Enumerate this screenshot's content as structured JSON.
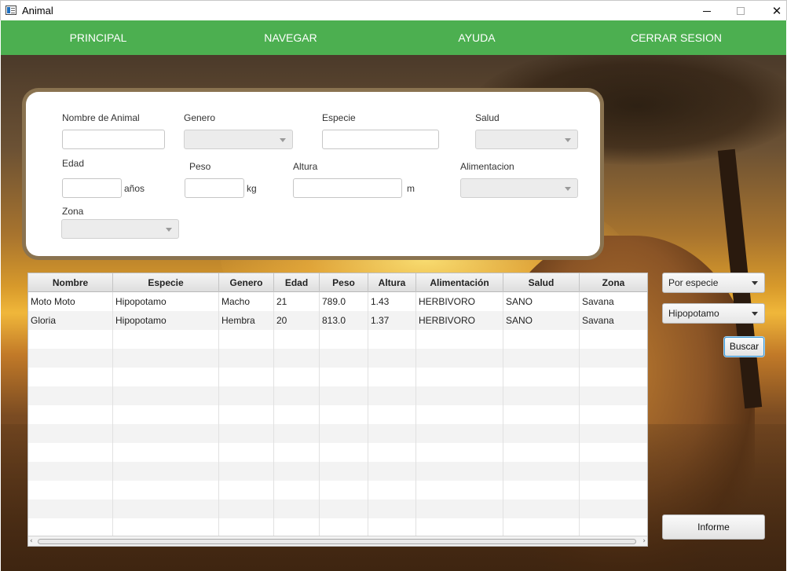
{
  "window": {
    "title": "Animal",
    "icon": "app-window-icon"
  },
  "nav": {
    "principal": "PRINCIPAL",
    "navegar": "NAVEGAR",
    "ayuda": "AYUDA",
    "cerrar_sesion": "CERRAR SESION",
    "color": "#4caf50"
  },
  "form": {
    "nombre_label": "Nombre de Animal",
    "genero_label": "Genero",
    "especie_label": "Especie",
    "salud_label": "Salud",
    "edad_label": "Edad",
    "edad_unit": "años",
    "peso_label": "Peso",
    "peso_unit": "kg",
    "altura_label": "Altura",
    "altura_unit": "m",
    "alimentacion_label": "Alimentacion",
    "zona_label": "Zona",
    "values": {
      "nombre": "",
      "genero": "",
      "especie": "",
      "salud": "",
      "edad": "",
      "peso": "",
      "altura": "",
      "alimentacion": "",
      "zona": ""
    }
  },
  "table": {
    "columns": [
      "Nombre",
      "Especie",
      "Genero",
      "Edad",
      "Peso",
      "Altura",
      "Alimentación",
      "Salud",
      "Zona"
    ],
    "rows": [
      [
        "Moto Moto",
        "Hipopotamo",
        "Macho",
        "21",
        "789.0",
        "1.43",
        "HERBIVORO",
        "SANO",
        "Savana"
      ],
      [
        "Gloria",
        "Hipopotamo",
        "Hembra",
        "20",
        "813.0",
        "1.37",
        "HERBIVORO",
        "SANO",
        "Savana"
      ]
    ]
  },
  "search": {
    "filter_type": "Por especie",
    "filter_value": "Hipopotamo",
    "search_button": "Buscar",
    "report_button": "Informe",
    "focus_color": "#3c9ad8"
  }
}
